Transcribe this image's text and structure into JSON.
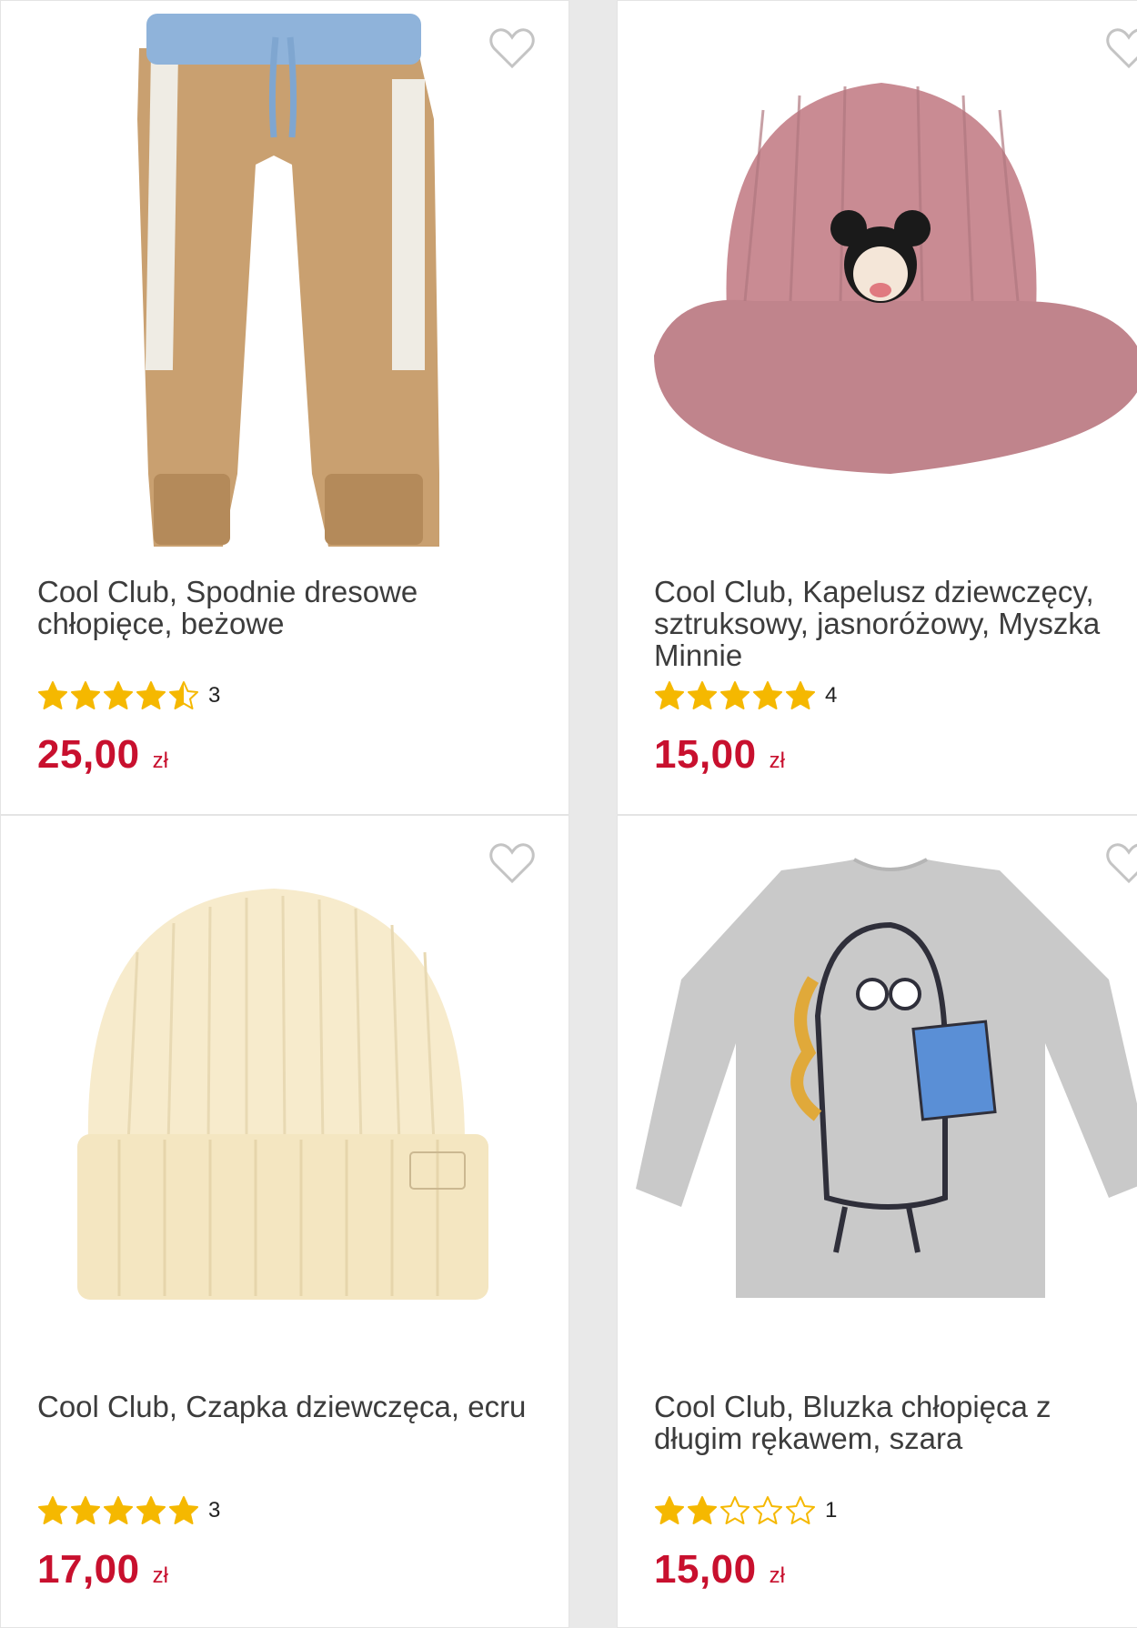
{
  "products": [
    {
      "title": "Cool Club, Spodnie dresowe chłopięce, beżowe",
      "rating": 4.5,
      "rating_count": "3",
      "price": "25,00",
      "currency": "zł",
      "image_icon": "sweatpants-icon",
      "favorite_icon": "heart-icon"
    },
    {
      "title": "Cool Club, Kapelusz dziewczęcy, sztruksowy, jasnoróżowy, Myszka Minnie",
      "rating": 5,
      "rating_count": "4",
      "price": "15,00",
      "currency": "zł",
      "image_icon": "bucket-hat-icon",
      "favorite_icon": "heart-icon"
    },
    {
      "title": "Cool Club, Czapka dziewczęca, ecru",
      "rating": 5,
      "rating_count": "3",
      "price": "17,00",
      "currency": "zł",
      "image_icon": "beanie-icon",
      "favorite_icon": "heart-icon"
    },
    {
      "title": "Cool Club, Bluzka chłopięca z długim rękawem, szara",
      "rating": 2,
      "rating_count": "1",
      "price": "15,00",
      "currency": "zł",
      "image_icon": "long-sleeve-shirt-icon",
      "favorite_icon": "heart-icon"
    }
  ],
  "colors": {
    "price": "#c8102e",
    "star": "#f5b800",
    "title": "#3c3c3c"
  }
}
